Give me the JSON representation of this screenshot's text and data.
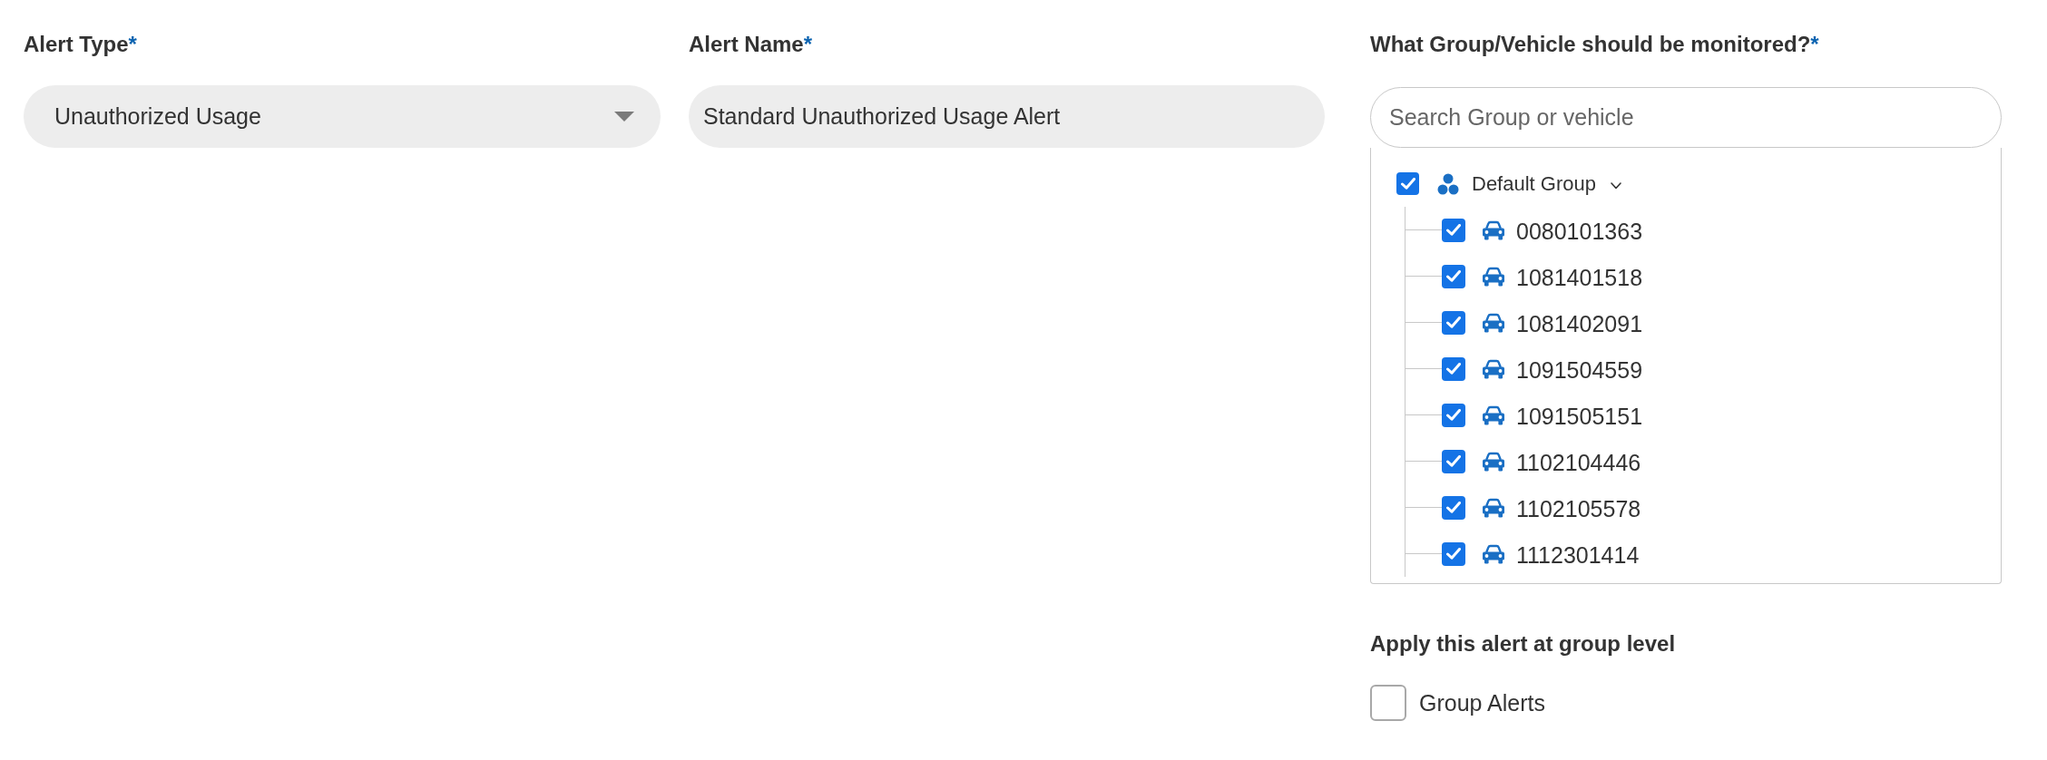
{
  "fields": [
    {
      "label": "Alert Type",
      "required_mark": "*",
      "kind": "select",
      "value": "Unauthorized Usage"
    },
    {
      "label": "Alert Name",
      "required_mark": "*",
      "kind": "text",
      "value": "Standard Unauthorized Usage Alert"
    }
  ],
  "monitor": {
    "label": "What Group/Vehicle should be monitored?",
    "required_mark": "*",
    "search": {
      "placeholder": "Search Group or vehicle"
    },
    "tree": [
      {
        "label": "Default Group",
        "kind": "group",
        "checked": true,
        "expanded": true,
        "children": [
          {
            "label": "0080101363",
            "kind": "vehicle",
            "checked": true
          },
          {
            "label": "1081401518",
            "kind": "vehicle",
            "checked": true
          },
          {
            "label": "1081402091",
            "kind": "vehicle",
            "checked": true
          },
          {
            "label": "1091504559",
            "kind": "vehicle",
            "checked": true
          },
          {
            "label": "1091505151",
            "kind": "vehicle",
            "checked": true
          },
          {
            "label": "1102104446",
            "kind": "vehicle",
            "checked": true
          },
          {
            "label": "1102105578",
            "kind": "vehicle",
            "checked": true
          },
          {
            "label": "1112301414",
            "kind": "vehicle",
            "checked": true
          }
        ]
      }
    ]
  },
  "group_level": {
    "label": "Apply this alert at group level",
    "options": [
      {
        "label": "Group Alerts",
        "checked": false
      }
    ]
  }
}
